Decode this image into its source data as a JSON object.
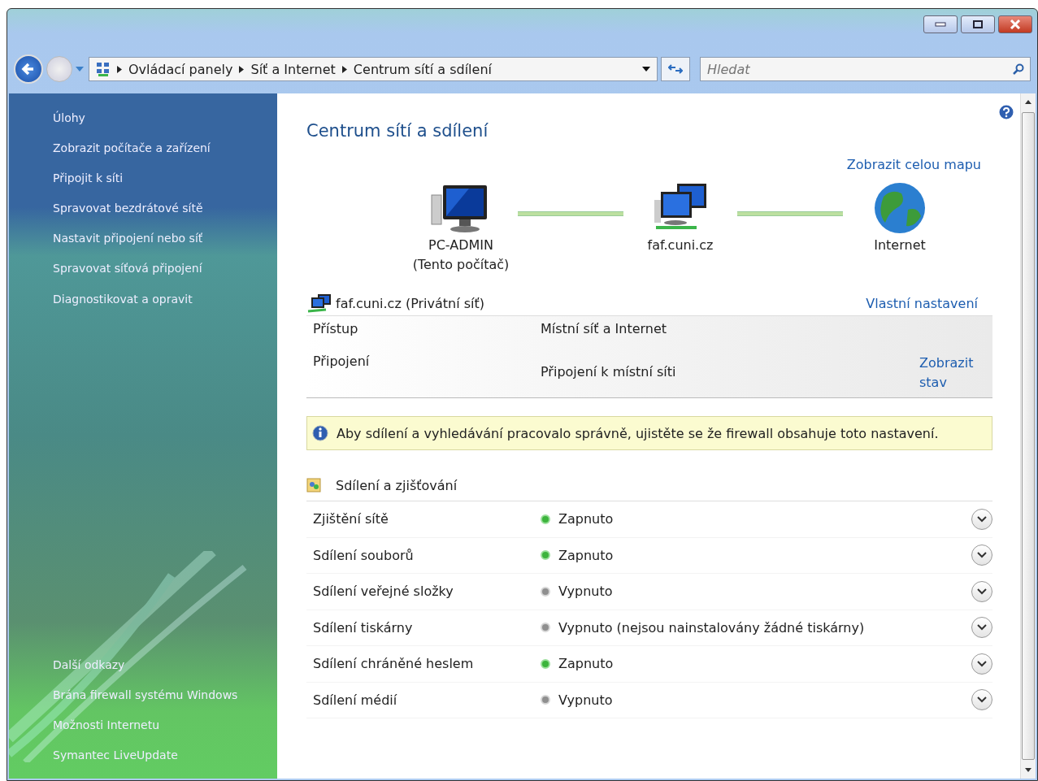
{
  "address_bar": {
    "breadcrumbs": [
      "Ovládací panely",
      "Síť a Internet",
      "Centrum sítí a sdílení"
    ]
  },
  "search": {
    "placeholder": "Hledat"
  },
  "sidebar": {
    "tasks_heading": "Úlohy",
    "tasks": [
      "Zobrazit počítače a zařízení",
      "Připojit k síti",
      "Spravovat bezdrátové sítě",
      "Nastavit připojení nebo síť",
      "Spravovat síťová připojení",
      "Diagnostikovat a opravit"
    ],
    "links_heading": "Další odkazy",
    "links": [
      "Brána firewall systému Windows",
      "Možnosti Internetu",
      "Symantec LiveUpdate"
    ]
  },
  "page_title": "Centrum sítí a sdílení",
  "map_link": "Zobrazit celou mapu",
  "network_map": [
    {
      "kind": "computer",
      "label": "PC-ADMIN",
      "sublabel": "(Tento počítač)"
    },
    {
      "kind": "network",
      "label": "faf.cuni.cz"
    },
    {
      "kind": "internet",
      "label": "Internet"
    }
  ],
  "network": {
    "name": "faf.cuni.cz (Privátní síť)",
    "customize_link": "Vlastní nastavení",
    "rows": [
      {
        "label": "Přístup",
        "value": "Místní síť a Internet"
      },
      {
        "label": "Připojení",
        "value": "Připojení k místní síti",
        "link": "Zobrazit stav"
      }
    ]
  },
  "info_banner": "Aby sdílení a vyhledávání pracovalo správně, ujistěte se že firewall obsahuje toto nastavení.",
  "sharing": {
    "heading": "Sdílení a zjišťování",
    "rows": [
      {
        "label": "Zjištění sítě",
        "status": "Zapnuto",
        "on": true
      },
      {
        "label": "Sdílení souborů",
        "status": "Zapnuto",
        "on": true
      },
      {
        "label": "Sdílení veřejné složky",
        "status": "Vypnuto",
        "on": false
      },
      {
        "label": "Sdílení tiskárny",
        "status": "Vypnuto (nejsou nainstalovány žádné tiskárny)",
        "on": false
      },
      {
        "label": "Sdílení chráněné heslem",
        "status": "Zapnuto",
        "on": true
      },
      {
        "label": "Sdílení médií",
        "status": "Vypnuto",
        "on": false
      }
    ]
  }
}
